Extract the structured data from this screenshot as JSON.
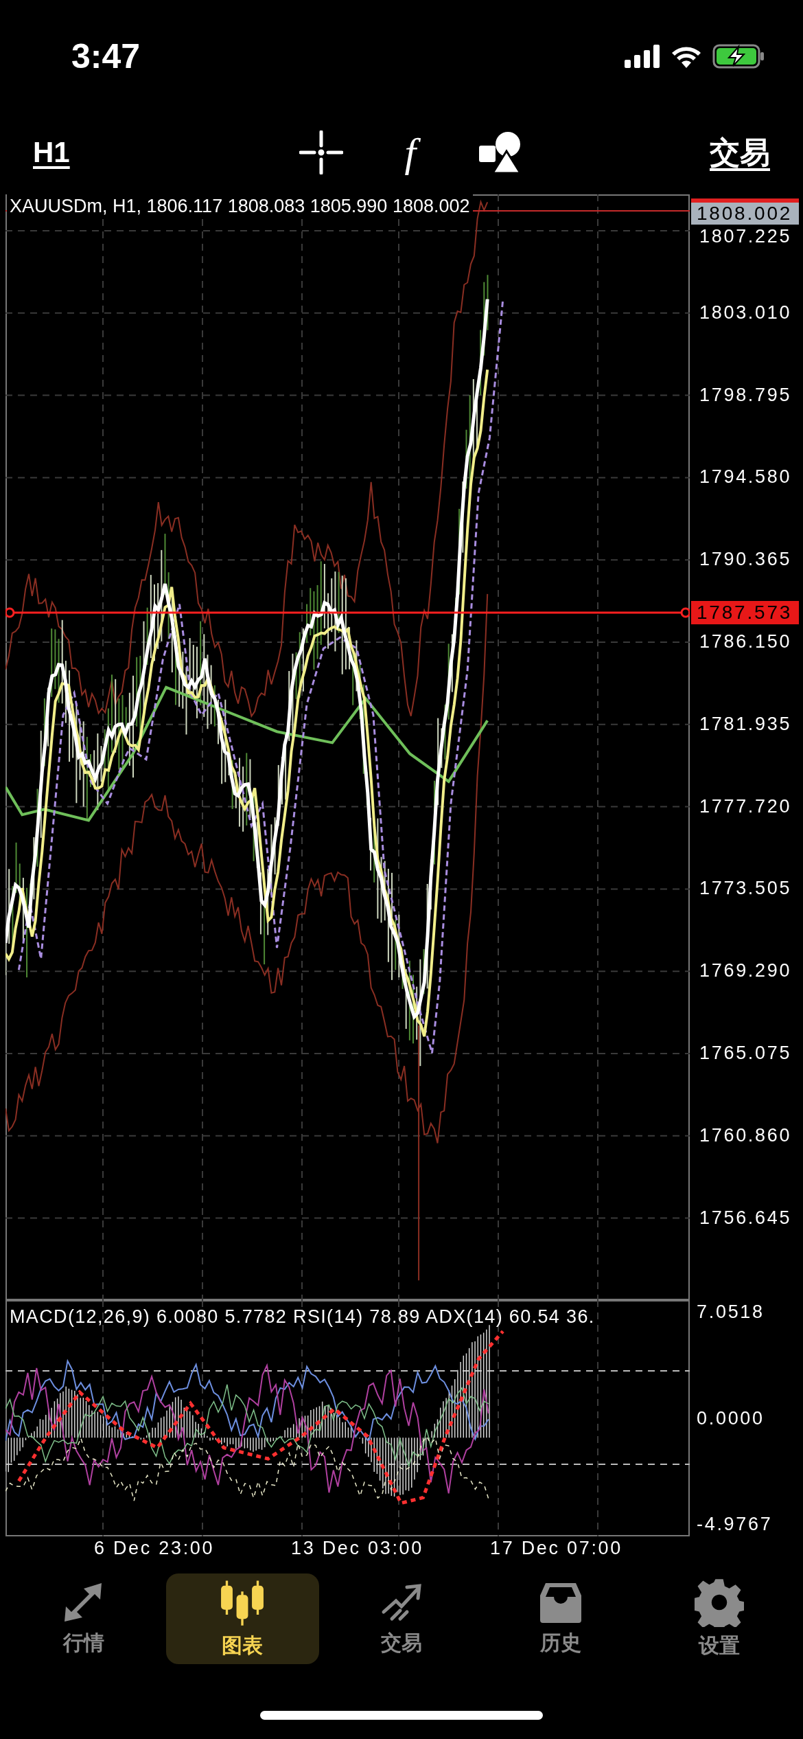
{
  "status_bar": {
    "time": "3:47"
  },
  "toolbar": {
    "timeframe": "H1",
    "function_symbol": "f",
    "trade": "交易"
  },
  "chart": {
    "legend": "XAUUSDm, H1, 1806.117 1808.083 1805.990 1808.002",
    "price_axis": [
      "1807.225",
      "1803.010",
      "1798.795",
      "1794.580",
      "1790.365",
      "1786.150",
      "1781.935",
      "1777.720",
      "1773.505",
      "1769.290",
      "1765.075",
      "1760.860",
      "1756.645"
    ],
    "bid_tag": "1808.002",
    "line_tag": "1787.573",
    "indicator_legend": "MACD(12,26,9) 6.0080 5.7782 RSI(14) 78.89 ADX(14) 60.54 36.",
    "indicator_axis": [
      "7.0518",
      "0.0000",
      "-4.9767"
    ],
    "time_axis": [
      "6 Dec 23:00",
      "13 Dec 03:00",
      "17 Dec 07:00"
    ]
  },
  "tab_bar": [
    {
      "label": "行情",
      "selected": false
    },
    {
      "label": "图表",
      "selected": true
    },
    {
      "label": "交易",
      "selected": false
    },
    {
      "label": "历史",
      "selected": false
    },
    {
      "label": "设置",
      "selected": false
    }
  ]
}
